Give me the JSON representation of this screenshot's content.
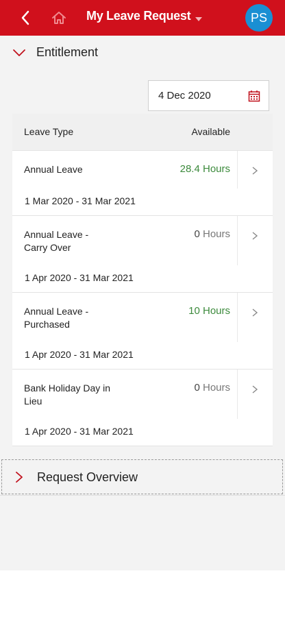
{
  "header": {
    "title": "My Leave Request",
    "avatar_initials": "PS",
    "accent": "#d0101c",
    "icons": [
      "back-arrow-icon",
      "home-icon",
      "caret-down-icon"
    ]
  },
  "entitlement": {
    "section_title": "Entitlement",
    "date_value": "4 Dec 2020",
    "table": {
      "columns": [
        "Leave Type",
        "Available"
      ],
      "rows": [
        {
          "type": "Annual Leave",
          "value": "28.4",
          "unit": "Hours",
          "period": "1 Mar 2020 - 31 Mar 2021"
        },
        {
          "type": "Annual Leave - Carry Over",
          "value": "0",
          "unit": "Hours",
          "period": "1 Apr 2020 - 31 Mar 2021"
        },
        {
          "type": "Annual Leave - Purchased",
          "value": "10",
          "unit": "Hours",
          "period": "1 Apr 2020 - 31 Mar 2021"
        },
        {
          "type": "Bank Holiday Day in Lieu",
          "value": "0",
          "unit": "Hours",
          "period": "1 Apr 2020 - 31 Mar 2021"
        }
      ]
    }
  },
  "request_overview": {
    "section_title": "Request Overview"
  }
}
